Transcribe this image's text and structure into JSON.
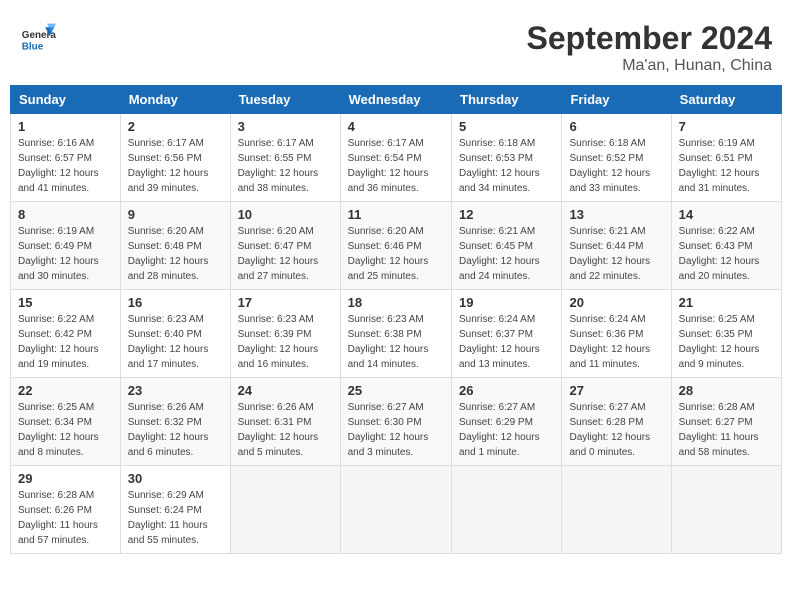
{
  "header": {
    "logo_line1": "General",
    "logo_line2": "Blue",
    "month": "September 2024",
    "location": "Ma'an, Hunan, China"
  },
  "days_of_week": [
    "Sunday",
    "Monday",
    "Tuesday",
    "Wednesday",
    "Thursday",
    "Friday",
    "Saturday"
  ],
  "weeks": [
    [
      {
        "day": "1",
        "info": "Sunrise: 6:16 AM\nSunset: 6:57 PM\nDaylight: 12 hours\nand 41 minutes."
      },
      {
        "day": "2",
        "info": "Sunrise: 6:17 AM\nSunset: 6:56 PM\nDaylight: 12 hours\nand 39 minutes."
      },
      {
        "day": "3",
        "info": "Sunrise: 6:17 AM\nSunset: 6:55 PM\nDaylight: 12 hours\nand 38 minutes."
      },
      {
        "day": "4",
        "info": "Sunrise: 6:17 AM\nSunset: 6:54 PM\nDaylight: 12 hours\nand 36 minutes."
      },
      {
        "day": "5",
        "info": "Sunrise: 6:18 AM\nSunset: 6:53 PM\nDaylight: 12 hours\nand 34 minutes."
      },
      {
        "day": "6",
        "info": "Sunrise: 6:18 AM\nSunset: 6:52 PM\nDaylight: 12 hours\nand 33 minutes."
      },
      {
        "day": "7",
        "info": "Sunrise: 6:19 AM\nSunset: 6:51 PM\nDaylight: 12 hours\nand 31 minutes."
      }
    ],
    [
      {
        "day": "8",
        "info": "Sunrise: 6:19 AM\nSunset: 6:49 PM\nDaylight: 12 hours\nand 30 minutes."
      },
      {
        "day": "9",
        "info": "Sunrise: 6:20 AM\nSunset: 6:48 PM\nDaylight: 12 hours\nand 28 minutes."
      },
      {
        "day": "10",
        "info": "Sunrise: 6:20 AM\nSunset: 6:47 PM\nDaylight: 12 hours\nand 27 minutes."
      },
      {
        "day": "11",
        "info": "Sunrise: 6:20 AM\nSunset: 6:46 PM\nDaylight: 12 hours\nand 25 minutes."
      },
      {
        "day": "12",
        "info": "Sunrise: 6:21 AM\nSunset: 6:45 PM\nDaylight: 12 hours\nand 24 minutes."
      },
      {
        "day": "13",
        "info": "Sunrise: 6:21 AM\nSunset: 6:44 PM\nDaylight: 12 hours\nand 22 minutes."
      },
      {
        "day": "14",
        "info": "Sunrise: 6:22 AM\nSunset: 6:43 PM\nDaylight: 12 hours\nand 20 minutes."
      }
    ],
    [
      {
        "day": "15",
        "info": "Sunrise: 6:22 AM\nSunset: 6:42 PM\nDaylight: 12 hours\nand 19 minutes."
      },
      {
        "day": "16",
        "info": "Sunrise: 6:23 AM\nSunset: 6:40 PM\nDaylight: 12 hours\nand 17 minutes."
      },
      {
        "day": "17",
        "info": "Sunrise: 6:23 AM\nSunset: 6:39 PM\nDaylight: 12 hours\nand 16 minutes."
      },
      {
        "day": "18",
        "info": "Sunrise: 6:23 AM\nSunset: 6:38 PM\nDaylight: 12 hours\nand 14 minutes."
      },
      {
        "day": "19",
        "info": "Sunrise: 6:24 AM\nSunset: 6:37 PM\nDaylight: 12 hours\nand 13 minutes."
      },
      {
        "day": "20",
        "info": "Sunrise: 6:24 AM\nSunset: 6:36 PM\nDaylight: 12 hours\nand 11 minutes."
      },
      {
        "day": "21",
        "info": "Sunrise: 6:25 AM\nSunset: 6:35 PM\nDaylight: 12 hours\nand 9 minutes."
      }
    ],
    [
      {
        "day": "22",
        "info": "Sunrise: 6:25 AM\nSunset: 6:34 PM\nDaylight: 12 hours\nand 8 minutes."
      },
      {
        "day": "23",
        "info": "Sunrise: 6:26 AM\nSunset: 6:32 PM\nDaylight: 12 hours\nand 6 minutes."
      },
      {
        "day": "24",
        "info": "Sunrise: 6:26 AM\nSunset: 6:31 PM\nDaylight: 12 hours\nand 5 minutes."
      },
      {
        "day": "25",
        "info": "Sunrise: 6:27 AM\nSunset: 6:30 PM\nDaylight: 12 hours\nand 3 minutes."
      },
      {
        "day": "26",
        "info": "Sunrise: 6:27 AM\nSunset: 6:29 PM\nDaylight: 12 hours\nand 1 minute."
      },
      {
        "day": "27",
        "info": "Sunrise: 6:27 AM\nSunset: 6:28 PM\nDaylight: 12 hours\nand 0 minutes."
      },
      {
        "day": "28",
        "info": "Sunrise: 6:28 AM\nSunset: 6:27 PM\nDaylight: 11 hours\nand 58 minutes."
      }
    ],
    [
      {
        "day": "29",
        "info": "Sunrise: 6:28 AM\nSunset: 6:26 PM\nDaylight: 11 hours\nand 57 minutes."
      },
      {
        "day": "30",
        "info": "Sunrise: 6:29 AM\nSunset: 6:24 PM\nDaylight: 11 hours\nand 55 minutes."
      },
      {
        "day": "",
        "info": ""
      },
      {
        "day": "",
        "info": ""
      },
      {
        "day": "",
        "info": ""
      },
      {
        "day": "",
        "info": ""
      },
      {
        "day": "",
        "info": ""
      }
    ]
  ]
}
